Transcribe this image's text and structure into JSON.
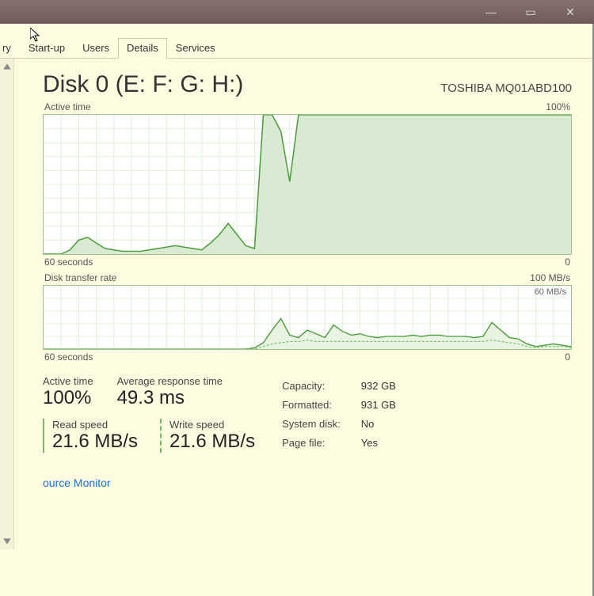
{
  "titlebar": {
    "minimize_glyph": "—",
    "maximize_glyph": "▭",
    "close_glyph": "✕"
  },
  "tabs": {
    "partial": "ry",
    "startup": "Start-up",
    "users": "Users",
    "details": "Details",
    "services": "Services"
  },
  "header": {
    "title": "Disk 0 (E: F: G: H:)",
    "model": "TOSHIBA MQ01ABD100"
  },
  "chart1": {
    "label_top_left": "Active time",
    "label_top_right": "100%",
    "label_bottom_left": "60 seconds",
    "label_bottom_right": "0"
  },
  "chart2": {
    "label_top_left": "Disk transfer rate",
    "label_top_right": "100 MB/s",
    "label_mid_right": "60 MB/s",
    "label_bottom_left": "60 seconds",
    "label_bottom_right": "0"
  },
  "stats": {
    "active_time_lbl": "Active time",
    "active_time_val": "100%",
    "avg_resp_lbl": "Average response time",
    "avg_resp_val": "49.3 ms",
    "read_lbl": "Read speed",
    "read_val": "21.6 MB/s",
    "write_lbl": "Write speed",
    "write_val": "21.6 MB/s"
  },
  "info": {
    "capacity_lbl": "Capacity:",
    "capacity_val": "932 GB",
    "formatted_lbl": "Formatted:",
    "formatted_val": "931 GB",
    "system_disk_lbl": "System disk:",
    "system_disk_val": "No",
    "pagefile_lbl": "Page file:",
    "pagefile_val": "Yes"
  },
  "link": {
    "resource_monitor": "ource Monitor"
  },
  "chart_data": [
    {
      "type": "area",
      "title": "Active time",
      "ylabel": "Active time (%)",
      "xlabel": "seconds",
      "x_range_seconds": [
        60,
        0
      ],
      "ylim": [
        0,
        100
      ],
      "series": [
        {
          "name": "Active time %",
          "values": [
            0,
            0,
            0,
            3,
            10,
            12,
            8,
            4,
            3,
            2,
            2,
            2,
            3,
            4,
            5,
            6,
            5,
            4,
            3,
            8,
            14,
            22,
            14,
            6,
            4,
            100,
            100,
            88,
            52,
            100,
            100,
            100,
            100,
            100,
            100,
            100,
            100,
            100,
            100,
            100,
            100,
            100,
            100,
            100,
            100,
            100,
            100,
            100,
            100,
            100,
            100,
            100,
            100,
            100,
            100,
            100,
            100,
            100,
            100,
            100,
            100
          ]
        }
      ]
    },
    {
      "type": "line",
      "title": "Disk transfer rate",
      "ylabel": "MB/s",
      "xlabel": "seconds",
      "x_range_seconds": [
        60,
        0
      ],
      "ylim": [
        0,
        100
      ],
      "series": [
        {
          "name": "Read speed (MB/s)",
          "values": [
            0,
            0,
            0,
            0,
            0,
            0,
            0,
            0,
            0,
            0,
            0,
            0,
            0,
            0,
            0,
            0,
            0,
            0,
            0,
            0,
            0,
            0,
            0,
            0,
            2,
            10,
            30,
            48,
            22,
            18,
            30,
            24,
            18,
            38,
            28,
            22,
            24,
            20,
            18,
            20,
            20,
            20,
            22,
            20,
            22,
            22,
            20,
            20,
            20,
            18,
            20,
            42,
            30,
            18,
            16,
            8,
            4,
            6,
            8,
            6,
            4
          ]
        },
        {
          "name": "Write speed (MB/s)",
          "values": [
            0,
            0,
            0,
            0,
            0,
            0,
            0,
            0,
            0,
            0,
            0,
            0,
            0,
            0,
            0,
            0,
            0,
            0,
            0,
            0,
            0,
            0,
            0,
            0,
            0,
            4,
            8,
            10,
            12,
            12,
            14,
            12,
            12,
            12,
            12,
            12,
            12,
            12,
            12,
            12,
            12,
            12,
            12,
            12,
            12,
            12,
            12,
            12,
            12,
            12,
            12,
            14,
            12,
            10,
            8,
            4,
            2,
            4,
            4,
            4,
            2
          ]
        }
      ]
    }
  ]
}
